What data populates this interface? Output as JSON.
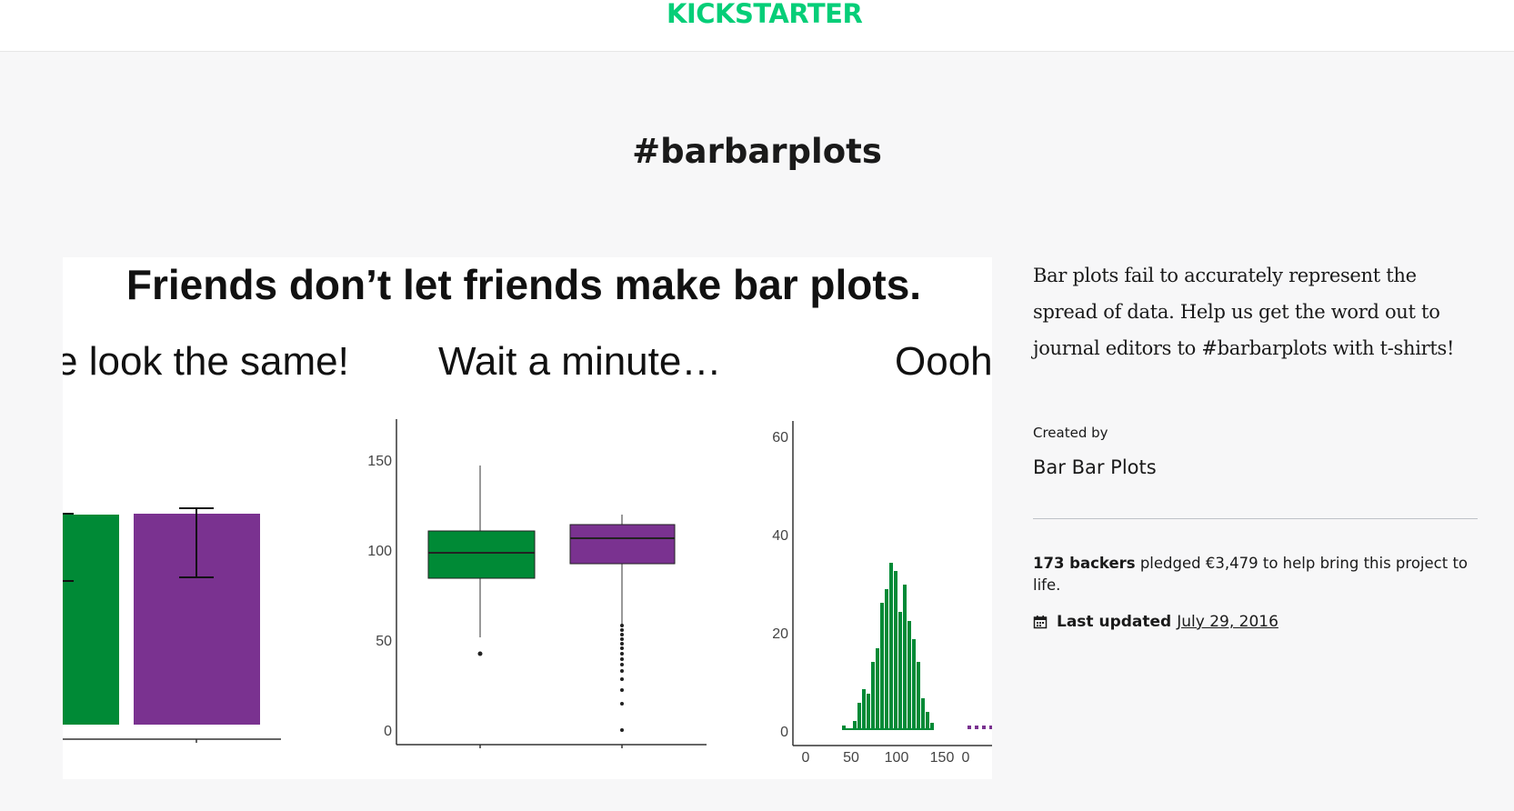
{
  "header": {
    "logo_text": "KICKSTARTER",
    "logo_color": "#05ce78"
  },
  "project": {
    "title": "#barbarplots",
    "blurb": "Bar plots fail to accurately represent the spread of data. Help us get the word out to journal editors to #barbarplots with t-shirts!",
    "created_by_label": "Created by",
    "creator_name": "Bar Bar Plots",
    "backers": "173 backers",
    "pledged_text": " pledged €3,479 to help bring this project to life.",
    "last_updated_label": "Last updated",
    "last_updated_date": "July 29, 2016",
    "calendar_icon": "calendar-icon"
  },
  "media": {
    "headline": "Friends don’t let friends make bar plots.",
    "panel_titles": [
      "e look the same!",
      "Wait a minute…",
      "Oooh"
    ],
    "colors": {
      "green": "#008a36",
      "purple": "#7a3290"
    },
    "box_y_ticks": [
      "150",
      "100",
      "50",
      "0"
    ],
    "hist_y_ticks": [
      "60",
      "40",
      "20",
      "0"
    ],
    "hist_x_ticks": [
      "0",
      "50",
      "100",
      "150",
      "0"
    ]
  }
}
